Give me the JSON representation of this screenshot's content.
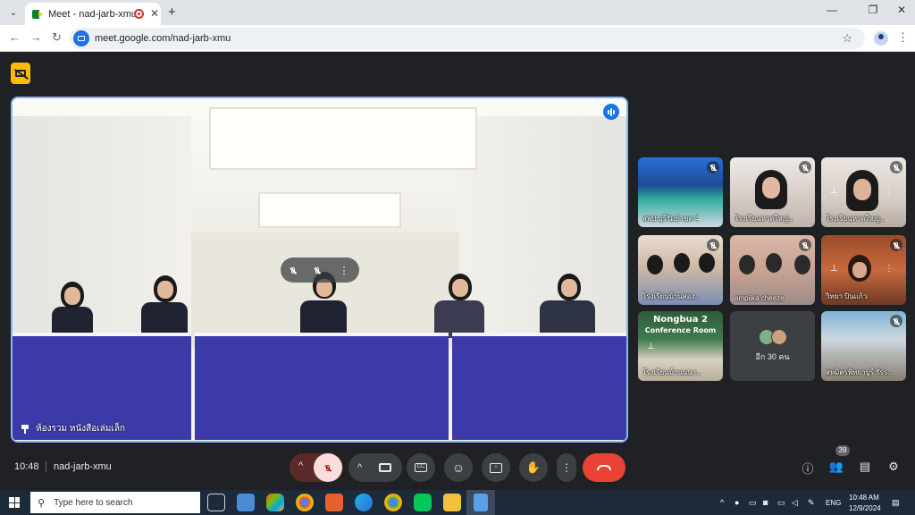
{
  "browser": {
    "tab_title": "Meet - nad-jarb-xmu",
    "tab_close": "✕",
    "new_tab": "+",
    "url": "meet.google.com/nad-jarb-xmu",
    "window_controls": [
      "—",
      "❐",
      "✕"
    ]
  },
  "meeting": {
    "main_speaker_name": "ห้องรวม หนังสือเล่มเล็ก",
    "side_tiles": [
      {
        "label": "สพป.บุรีรัมย์ เขต 4"
      },
      {
        "label": "โรงเรียนหาดใหญ่..."
      },
      {
        "label": "โรงเรียนหาดใหญ่..."
      },
      {
        "label": "โรงเรียนบ้านสอง..."
      },
      {
        "label": "ampiika cheeze"
      },
      {
        "label": "วิทยา ปินแก้ว"
      },
      {
        "label": "โรงเรียนบ้านนนา...",
        "banner1": "Nongbua 2",
        "banner2": "Conference Room"
      },
      {
        "label": "อีก 30 คน"
      },
      {
        "label": "สหมิตรพิทยาบูร์ รัรร..."
      }
    ],
    "time": "10:48",
    "code": "nad-jarb-xmu",
    "people_count": "39"
  },
  "taskbar": {
    "search_placeholder": "Type here to search",
    "lang": "ENG",
    "clock_time": "10:48 AM",
    "clock_date": "12/9/2024"
  },
  "colors": {
    "meet_bg": "#202124",
    "accent": "#8ab4f8",
    "end_call": "#ea4335",
    "cam_off_badge": "#fbbc04"
  }
}
